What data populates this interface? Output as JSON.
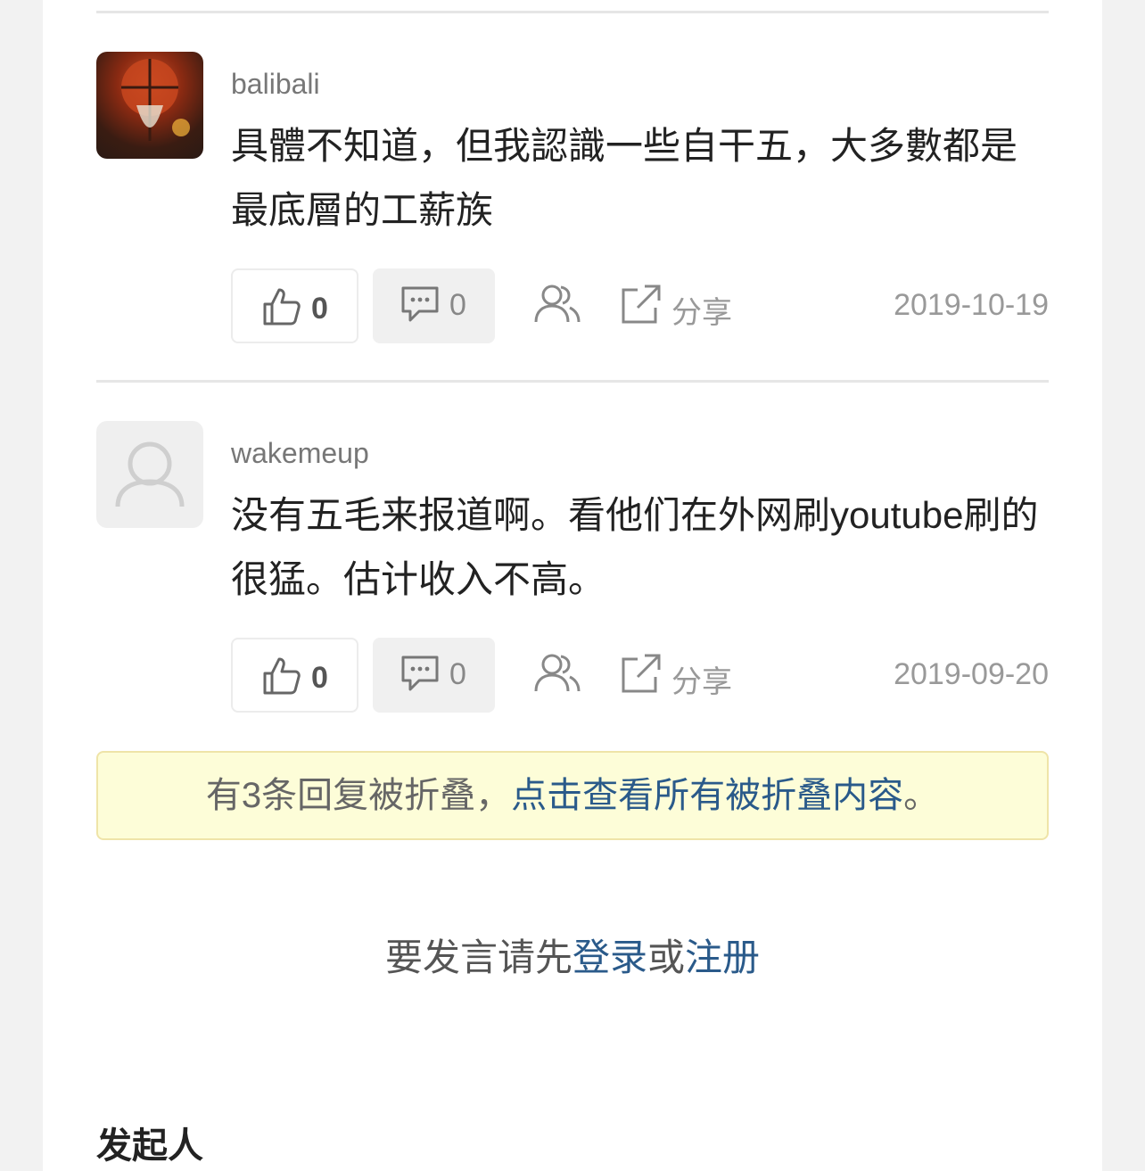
{
  "comments": [
    {
      "username": "balibali",
      "text": "具體不知道，但我認識一些自干五，大多數都是最底層的工薪族",
      "likes": "0",
      "replies": "0",
      "share_label": "分享",
      "date": "2019-10-19",
      "avatar": "user-photo"
    },
    {
      "username": "wakemeup",
      "text": "没有五毛来报道啊。看他们在外网刷youtube刷的很猛。估计收入不高。",
      "likes": "0",
      "replies": "0",
      "share_label": "分享",
      "date": "2019-09-20",
      "avatar": "default-avatar"
    }
  ],
  "fold_notice": {
    "prefix": "有3条回复被折叠，",
    "link": "点击查看所有被折叠内容",
    "suffix": "。"
  },
  "login_prompt": {
    "prefix": "要发言请先",
    "login_link": "登录",
    "middle": "或",
    "register_link": "注册"
  },
  "section_title": "发起人",
  "colors": {
    "link": "#2a5a8a",
    "fold_bg": "#fdfdd8",
    "fold_border": "#efe4a8"
  },
  "icons": [
    "thumbs-up-icon",
    "comment-icon",
    "users-icon",
    "share-icon",
    "default-avatar-icon"
  ]
}
